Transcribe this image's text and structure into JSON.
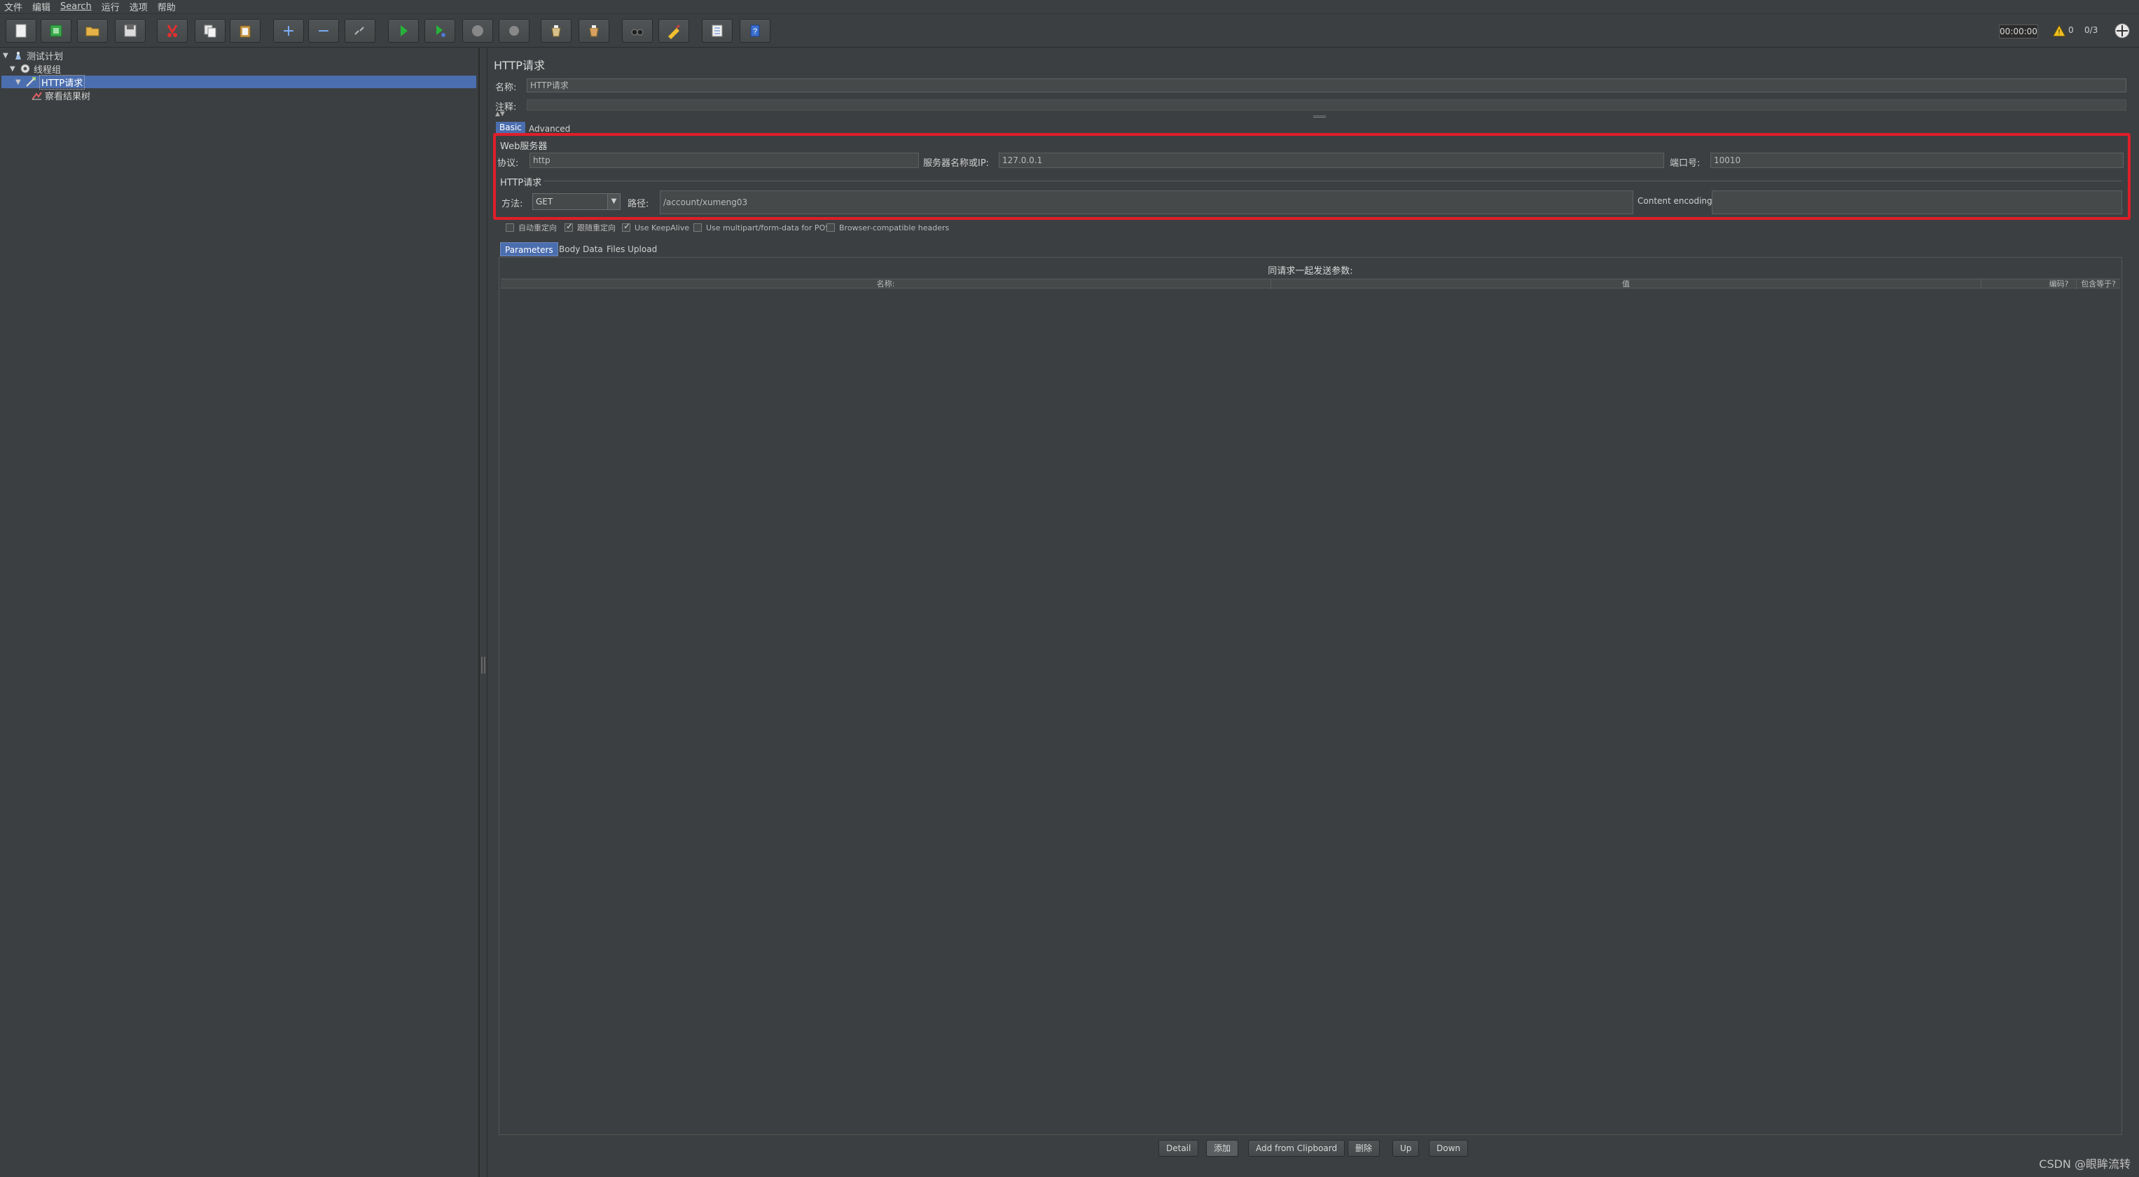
{
  "menu": [
    "文件",
    "编辑",
    "Search",
    "运行",
    "选项",
    "帮助"
  ],
  "toolbar": {
    "buttons": [
      "new-icon",
      "templates-icon",
      "open-icon",
      "save-icon",
      "cut-icon",
      "copy-icon",
      "paste-icon",
      "expand-icon",
      "collapse-icon",
      "toggle-icon",
      "start-icon",
      "start-no-pause-icon",
      "stop-icon",
      "shutdown-icon",
      "clear-icon",
      "clear-all-icon",
      "search-icon",
      "reset-search-icon",
      "function-helper-icon",
      "help-icon"
    ],
    "timer": "00:00:00",
    "warnings": "0",
    "threads": "0/3"
  },
  "tree": {
    "items": [
      {
        "label": "测试计划",
        "icon": "test-plan-icon",
        "level": 0
      },
      {
        "label": "线程组",
        "icon": "thread-group-icon",
        "level": 1
      },
      {
        "label": "HTTP请求",
        "icon": "http-sampler-icon",
        "level": 2,
        "selected": true
      },
      {
        "label": "察看结果树",
        "icon": "result-tree-icon",
        "level": 3
      }
    ]
  },
  "panel": {
    "title": "HTTP请求",
    "name_label": "名称:",
    "name_value": "HTTP请求",
    "comment_label": "注释:",
    "tabs": [
      "Basic",
      "Advanced"
    ],
    "web_server_title": "Web服务器",
    "protocol_label": "协议:",
    "protocol_value": "http",
    "server_label": "服务器名称或IP:",
    "server_value": "127.0.0.1",
    "port_label": "端口号:",
    "port_value": "10010",
    "http_request_title": "HTTP请求",
    "method_label": "方法:",
    "method_value": "GET",
    "path_label": "路径:",
    "path_value": "/account/xumeng03",
    "encoding_label": "Content encoding:",
    "encoding_value": "",
    "checkboxes": [
      {
        "label": "自动重定向",
        "checked": false
      },
      {
        "label": "跟随重定向",
        "checked": true
      },
      {
        "label": "Use KeepAlive",
        "checked": true
      },
      {
        "label": "Use multipart/form-data for POST",
        "checked": false
      },
      {
        "label": "Browser-compatible headers",
        "checked": false
      }
    ],
    "param_tabs": [
      "Parameters",
      "Body Data",
      "Files Upload"
    ],
    "params_caption": "同请求一起发送参数:",
    "table_headers": [
      "名称:",
      "值",
      "编码?",
      "包含等于?"
    ],
    "buttons": [
      "Detail",
      "添加",
      "Add from Clipboard",
      "删除",
      "Up",
      "Down"
    ]
  },
  "watermark": "CSDN @眼眸流转"
}
